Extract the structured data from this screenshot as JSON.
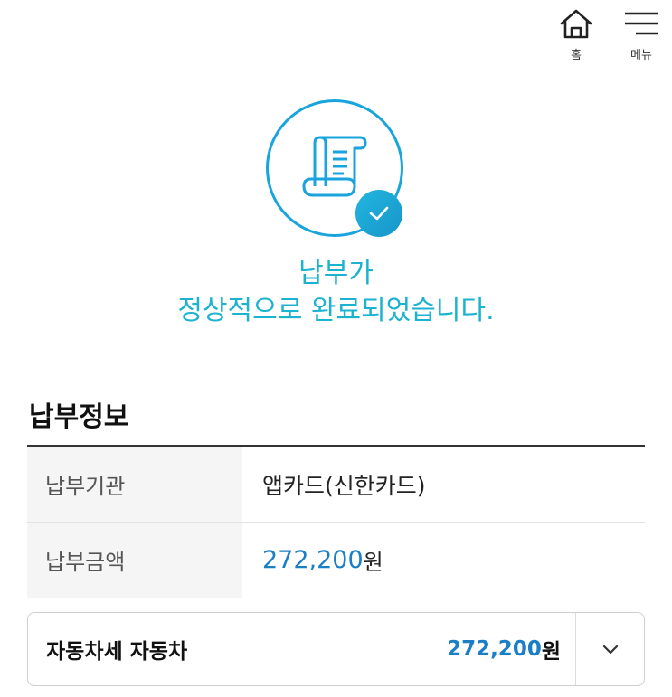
{
  "header": {
    "home_label": "홈",
    "menu_label": "메뉴"
  },
  "result": {
    "line1": "납부가",
    "line2": "정상적으로 완료되었습니다.",
    "accent_color": "#1bb3cf",
    "circle_color": "#1aa4dd"
  },
  "payment_info": {
    "title": "납부정보",
    "rows": [
      {
        "label": "납부기관",
        "value": "앱카드(신한카드)"
      },
      {
        "label": "납부금액",
        "amount": "272,200",
        "unit": "원"
      }
    ]
  },
  "detail": {
    "title": "자동차세 자동차",
    "amount": "272,200",
    "unit": "원",
    "toggle_icon": "chevron-down-icon"
  }
}
